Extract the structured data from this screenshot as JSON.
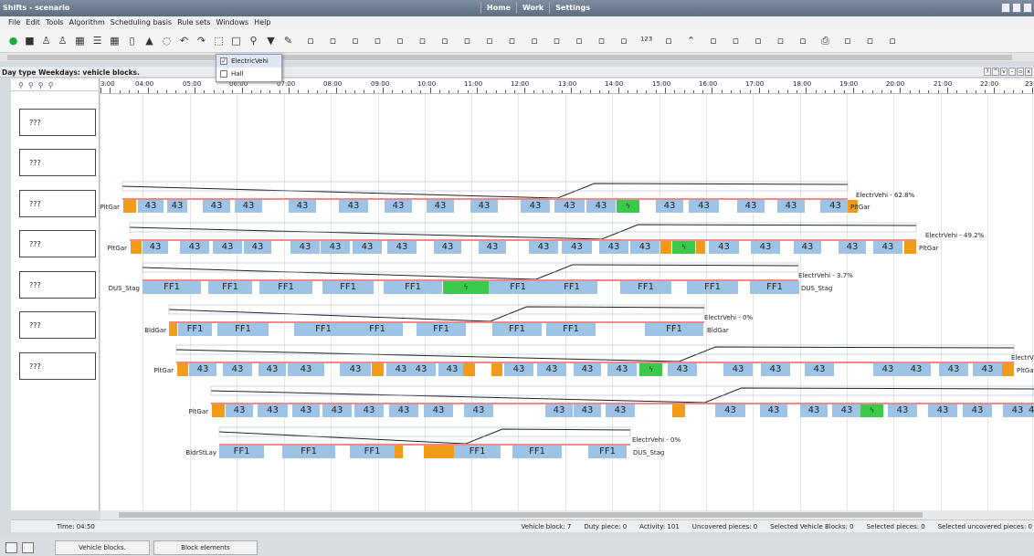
{
  "window": {
    "title": "Shifts - scenario",
    "nav": [
      "Home",
      "Work",
      "Settings"
    ]
  },
  "menu": [
    "File",
    "Edit",
    "Tools",
    "Algorithm",
    "Scheduling basis",
    "Rule sets",
    "Windows",
    "Help"
  ],
  "toolbar_icons": [
    "record-icon",
    "save-icon",
    "user-icon",
    "user-edit-icon",
    "calendar-icon",
    "list-icon",
    "table-icon",
    "document-icon",
    "triangle-icon",
    "clock-filter-icon",
    "undo-icon",
    "redo-icon",
    "select-icon",
    "window-icon",
    "search-icon",
    "filter-icon",
    "paint-icon",
    "link-icon",
    "cut-icon",
    "merge-icon",
    "split-icon",
    "insert-icon",
    "move-icon",
    "hook-icon",
    "bulb-icon",
    "copyright-icon",
    "thumb-icon",
    "magnet-icon",
    "line-icon",
    "clipboard-icon",
    "target-icon",
    "wrench-icon",
    "numbers-icon",
    "grid-icon",
    "chevron-up-icon",
    "brush-icon",
    "bucket-icon",
    "fill-icon",
    "fill2-icon",
    "align-icon",
    "printer-icon",
    "sort-icon",
    "frame-icon",
    "chart-icon"
  ],
  "dropdown": {
    "items": [
      {
        "label": "ElectricVehi",
        "checked": true
      },
      {
        "label": "Hall",
        "checked": false
      }
    ]
  },
  "pane": {
    "title": "Day type Weekdays: vehicle blocks."
  },
  "ruler": {
    "hours": [
      "3:00",
      "04:00",
      "05:00",
      "06:00",
      "07:00",
      "08:00",
      "09:00",
      "10:00",
      "11:00",
      "12:00",
      "13:00",
      "14:00",
      "15:00",
      "16:00",
      "17:00",
      "18:00",
      "19:00",
      "20:00",
      "21:00",
      "22:00",
      "23:"
    ]
  },
  "vehicles": [
    {
      "label": "???",
      "start": "PltGar",
      "end": "PltGar",
      "charge": "ElectrVehi - 62.8%"
    },
    {
      "label": "???",
      "start": "PltGar",
      "end": "PltGar",
      "charge": "ElectrVehi - 49.2%"
    },
    {
      "label": "???",
      "start": "DUS_Stag",
      "end": "DUS_Stag",
      "charge": "ElectrVehi - 3.7%"
    },
    {
      "label": "???",
      "start": "BldGar",
      "end": "BldGar",
      "charge": "ElectrVehi - 0%"
    },
    {
      "label": "???",
      "start": "PltGar",
      "end": "PltGar",
      "charge": "ElectrV"
    },
    {
      "label": "???",
      "start": "PltGar",
      "end": "",
      "charge": ""
    },
    {
      "label": "???",
      "start": "BldrStLay",
      "end": "DUS_Stag",
      "charge": "ElectrVehi - 0%"
    }
  ],
  "blocks": {
    "bus": "43",
    "ff": "FF1",
    "charge_symbol": "ϟ"
  },
  "status": {
    "time": "Time: 04:50",
    "items": [
      "Vehicle block: 7",
      "Duty piece: 0",
      "Activity: 101",
      "Uncovered pieces: 0",
      "Selected Vehicle Blocks: 0",
      "Selected pieces: 0",
      "Selected uncovered pieces: 0"
    ]
  },
  "bottom_tabs": [
    "Vehicle blocks.",
    "Block elements"
  ]
}
